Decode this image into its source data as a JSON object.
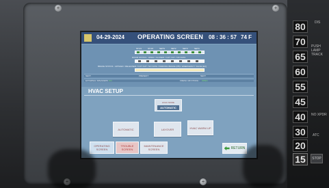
{
  "header": {
    "date": "04-29-2024",
    "title": "OPERATING SCREEN",
    "time": "08 : 36 : 57",
    "temperature": "74 F"
  },
  "status": {
    "door_status_prefix": "DOOR STATUS :",
    "door_status_open": "OPEN",
    "door_status_rest": "/ CLOSED / CUT OUT / NO DATA",
    "brake_status": "BRAKE STATUS : APPLIED / RELEASED / CUT OUT / NO DATA / PARKING BRAKE (PB) / EMERGENCY VALVE (EV)",
    "next_left": "NEXT",
    "present": "PRESENT",
    "next_right": "NEXT",
    "external_speakers_label": "EXTERNAL SPEAKERS :",
    "external_speakers_value": "ON",
    "fresh_air_label": "FRESH AIR INTAKE :",
    "fresh_air_value": "OPEN",
    "door_groups": [
      "ST-01",
      "ST-02",
      "SETS",
      "SET2",
      "SET3",
      "SET4"
    ]
  },
  "hvac": {
    "section_title": "HVAC SETUP",
    "mode_label": "HVAC MODE",
    "mode_value": "AUTOMATIC",
    "buttons": [
      "AUTOMATIC",
      "LAYOVER",
      "HVAC WARM UP"
    ]
  },
  "nav": {
    "operating": "OPERATING SCREEN",
    "trouble": "TROUBLE SCREEN",
    "maintenance": "MAINTENANCE SCREEN",
    "return": "RETURN"
  },
  "side_panel": {
    "speeds": [
      "80",
      "70",
      "65",
      "60",
      "55",
      "45",
      "40",
      "30",
      "20",
      "15"
    ],
    "labels": [
      "DIS",
      "PUSH LAMP TRACK",
      "NO XPDR",
      "ATC"
    ],
    "key_stop": "STOP"
  },
  "colors": {
    "screen_bg": "#7fa2bf",
    "header_bg": "#35507a",
    "button_text": "#8f4f4f",
    "status_green": "#3c8f3c"
  }
}
